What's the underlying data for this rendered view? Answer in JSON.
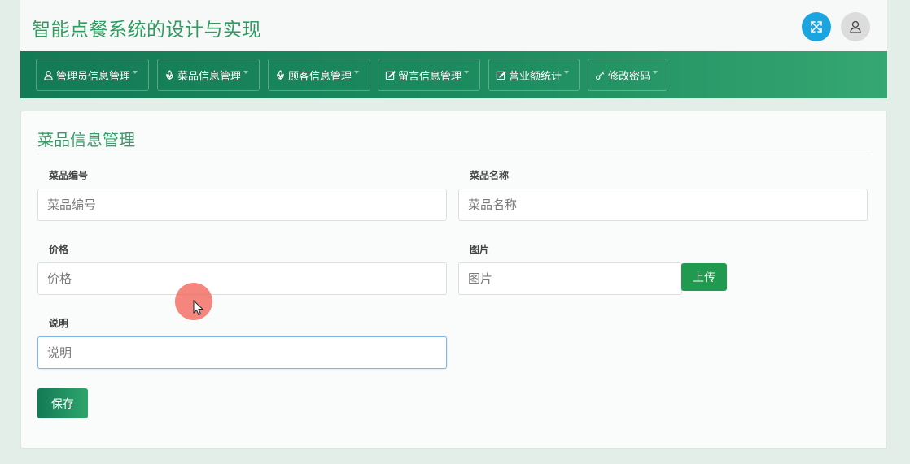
{
  "header": {
    "title": "智能点餐系统的设计与实现",
    "fullscreen_icon": "fullscreen-icon",
    "user_icon": "user-icon"
  },
  "nav": {
    "items": [
      {
        "label": "管理员信息管理",
        "icon": "user-icon"
      },
      {
        "label": "菜品信息管理",
        "icon": "leaf-icon"
      },
      {
        "label": "顾客信息管理",
        "icon": "leaf-icon"
      },
      {
        "label": "留言信息管理",
        "icon": "edit-icon"
      },
      {
        "label": "营业额统计",
        "icon": "edit-icon"
      },
      {
        "label": "修改密码",
        "icon": "key-icon"
      }
    ]
  },
  "form": {
    "title": "菜品信息管理",
    "fields": {
      "dish_id": {
        "label": "菜品编号",
        "placeholder": "菜品编号",
        "value": ""
      },
      "dish_name": {
        "label": "菜品名称",
        "placeholder": "菜品名称",
        "value": ""
      },
      "price": {
        "label": "价格",
        "placeholder": "价格",
        "value": ""
      },
      "image": {
        "label": "图片",
        "placeholder": "图片",
        "value": ""
      },
      "description": {
        "label": "说明",
        "placeholder": "说明",
        "value": ""
      }
    },
    "upload_label": "上传",
    "save_label": "保存"
  },
  "colors": {
    "accent": "#2e9c60",
    "nav_gradient_start": "#137a56",
    "nav_gradient_end": "#35a772",
    "fullscreen_button": "#1aa4e0",
    "upload_button": "#1f9a4e",
    "cursor_highlight": "#f2645a"
  }
}
